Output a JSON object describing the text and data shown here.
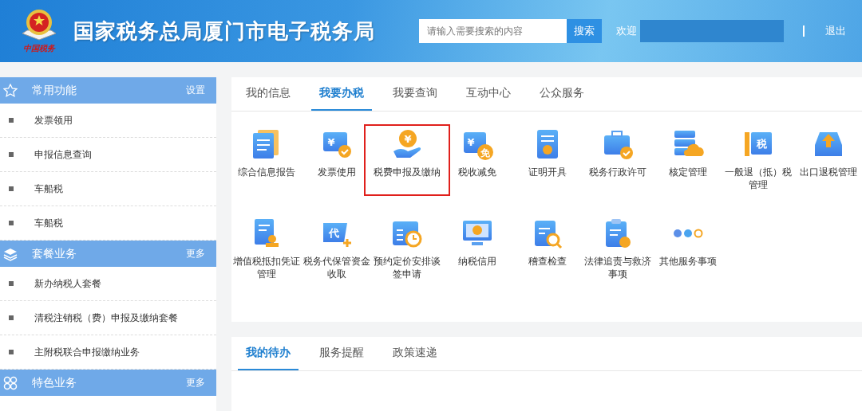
{
  "header": {
    "logo_caption": "中国税务",
    "title": "国家税务总局厦门市电子税务局",
    "search": {
      "placeholder": "请输入需要搜索的内容",
      "button": "搜索"
    },
    "welcome": "欢迎",
    "logout": "退出"
  },
  "sidebar": [
    {
      "title": "常用功能",
      "action": "设置",
      "items": [
        "发票领用",
        "申报信息查询",
        "车船税",
        "车船税"
      ]
    },
    {
      "title": "套餐业务",
      "action": "更多",
      "items": [
        "新办纳税人套餐",
        "清税注销税（费）申报及缴纳套餐",
        "主附税联合申报缴纳业务"
      ]
    },
    {
      "title": "特色业务",
      "action": "更多"
    }
  ],
  "main_tabs": [
    {
      "label": "我的信息",
      "selected": false
    },
    {
      "label": "我要办税",
      "selected": true
    },
    {
      "label": "我要查询",
      "selected": false
    },
    {
      "label": "互动中心",
      "selected": false
    },
    {
      "label": "公众服务",
      "selected": false
    }
  ],
  "services": [
    {
      "label": "综合信息报告",
      "kind": "doc",
      "highlighted": false
    },
    {
      "label": "发票使用",
      "kind": "ticket",
      "glyph": "¥",
      "highlighted": false
    },
    {
      "label": "税费申报及缴纳",
      "kind": "coin",
      "glyph": "¥",
      "highlighted": true
    },
    {
      "label": "税收减免",
      "kind": "card",
      "glyph": "¥",
      "badge": "免",
      "highlighted": false
    },
    {
      "label": "证明开具",
      "kind": "cert",
      "highlighted": false
    },
    {
      "label": "税务行政许可",
      "kind": "case",
      "highlighted": false
    },
    {
      "label": "核定管理",
      "kind": "server",
      "highlighted": false
    },
    {
      "label": "一般退（抵）税管理",
      "kind": "tag",
      "glyph": "税",
      "highlighted": false
    },
    {
      "label": "出口退税管理",
      "kind": "upload",
      "highlighted": false
    },
    {
      "label": "增值税抵扣凭证管理",
      "kind": "stamp",
      "highlighted": false
    },
    {
      "label": "税务代保管资金收取",
      "kind": "plus",
      "glyph": "代",
      "highlighted": false
    },
    {
      "label": "预约定价安排谈签申请",
      "kind": "calendar",
      "highlighted": false
    },
    {
      "label": "纳税信用",
      "kind": "monitor",
      "highlighted": false
    },
    {
      "label": "稽查检查",
      "kind": "search",
      "highlighted": false
    },
    {
      "label": "法律追责与救济事项",
      "kind": "clip",
      "highlighted": false
    },
    {
      "label": "其他服务事项",
      "kind": "dots",
      "highlighted": false
    }
  ],
  "todo_tabs": [
    {
      "label": "我的待办",
      "selected": true
    },
    {
      "label": "服务提醒",
      "selected": false
    },
    {
      "label": "政策速递",
      "selected": false
    }
  ]
}
